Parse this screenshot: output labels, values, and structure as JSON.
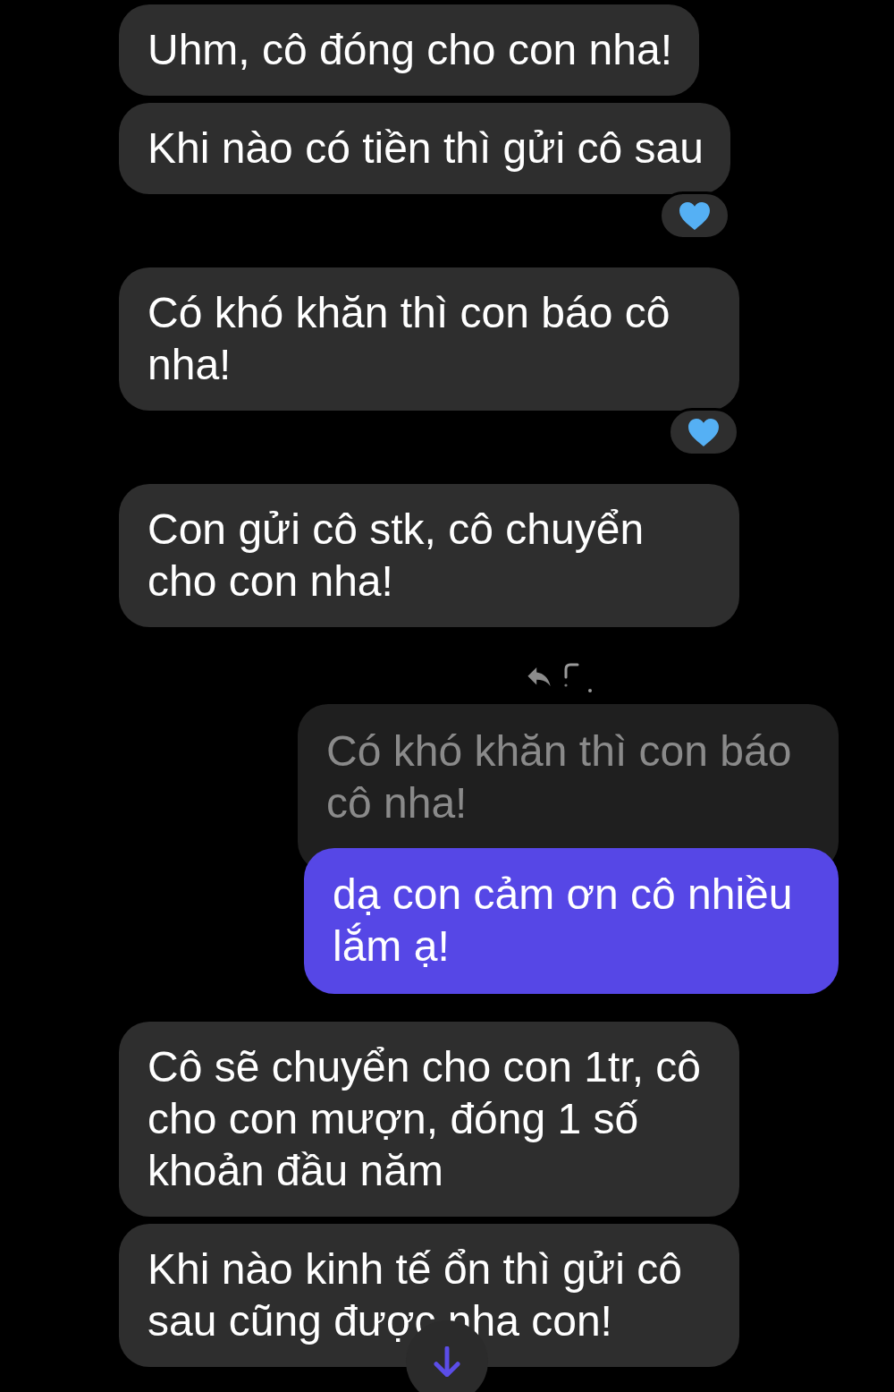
{
  "messages": [
    {
      "kind": "incoming",
      "text": "Uhm, cô đóng cho con nha!",
      "reacted": false
    },
    {
      "kind": "incoming",
      "text": "Khi nào có tiền thì gửi cô sau",
      "reacted": true
    },
    {
      "kind": "incoming",
      "text": "Có khó khăn thì con báo cô nha!",
      "reacted": true
    },
    {
      "kind": "incoming",
      "text": "Con gửi cô stk, cô chuyển cho con nha!",
      "reacted": false
    },
    {
      "kind": "reply",
      "quote": "Có khó khăn thì con báo cô nha!",
      "text": "dạ con cảm ơn cô nhiều lắm ạ!"
    },
    {
      "kind": "incoming",
      "text": "Cô sẽ chuyển cho con 1tr, cô cho con mượn, đóng 1 số khoản đầu năm",
      "reacted": false
    },
    {
      "kind": "incoming",
      "text": "Khi nào kinh tế ổn thì gửi cô sau cũng được nha con!",
      "reacted": false
    }
  ]
}
